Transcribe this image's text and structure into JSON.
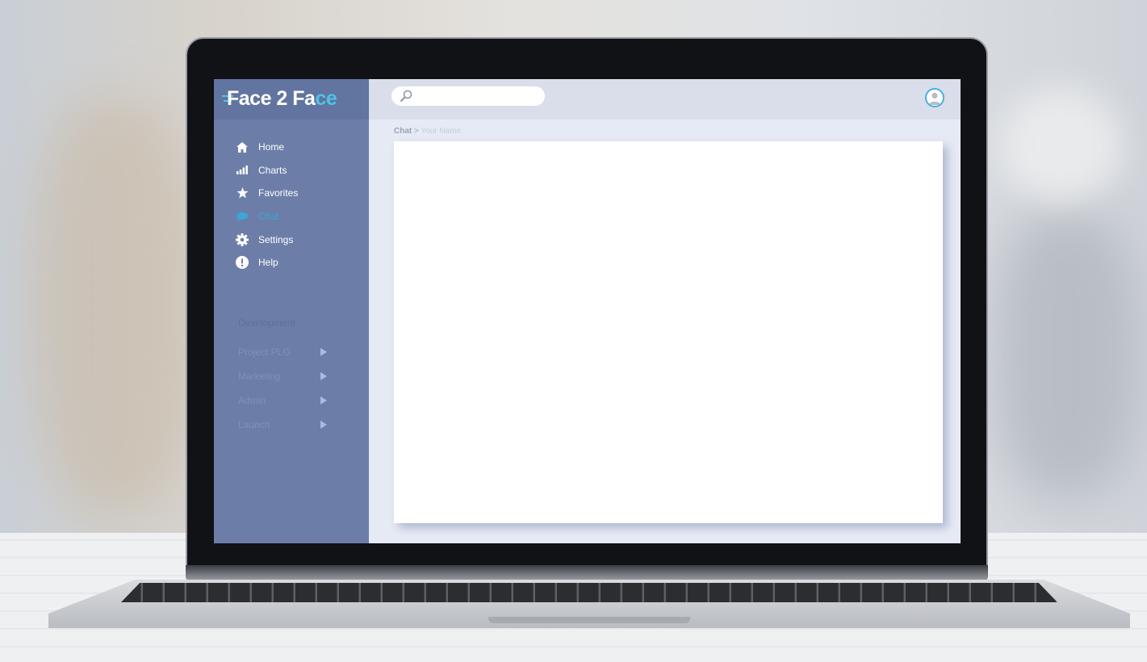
{
  "app": {
    "logo_text": "Face 2 Face",
    "accent_color": "#4ec3e9",
    "sidebar_color": "#6c7ea8"
  },
  "sidebar": {
    "nav": [
      {
        "label": "Home",
        "icon": "home-icon"
      },
      {
        "label": "Charts",
        "icon": "bar-chart-icon"
      },
      {
        "label": "Favorites",
        "icon": "star-icon"
      },
      {
        "label": "Chat",
        "icon": "chat-bubble-icon",
        "active": true
      },
      {
        "label": "Settings",
        "icon": "gear-icon"
      },
      {
        "label": "Help",
        "icon": "exclamation-icon"
      }
    ],
    "group_heading": "Development",
    "projects": [
      {
        "label": "Project PLG"
      },
      {
        "label": "Marketing"
      },
      {
        "label": "Admin"
      },
      {
        "label": "Launch"
      }
    ]
  },
  "topbar": {
    "search_placeholder": "",
    "search_icon": "search-icon",
    "avatar_icon": "user-avatar-icon"
  },
  "breadcrumb": {
    "root": "Chat",
    "separator": ">",
    "current": "Your Name"
  }
}
